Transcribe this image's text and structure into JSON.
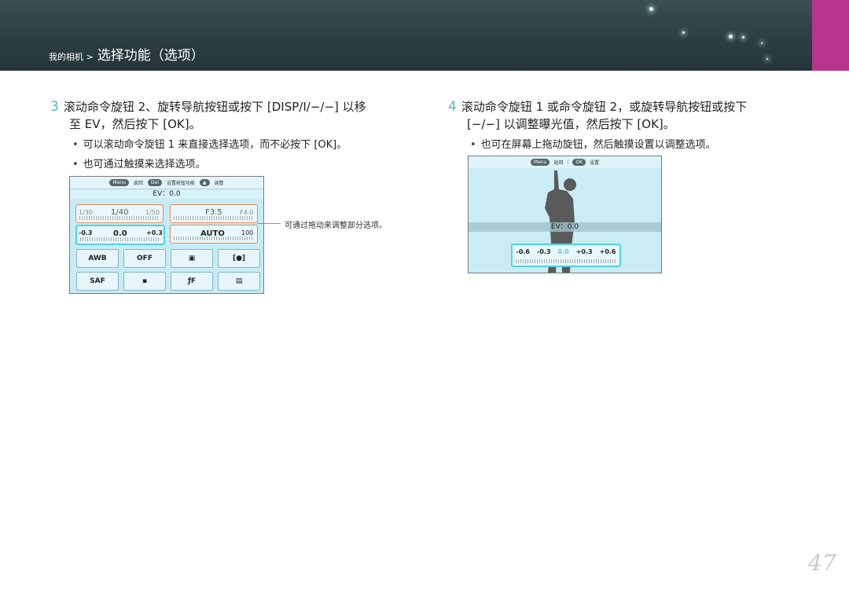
{
  "header": {
    "breadcrumb_small": "我的相机 >",
    "breadcrumb_big": "选择功能（选项）"
  },
  "step3": {
    "number": "3",
    "line1": "滚动命令旋钮 2、旋转导航按钮或按下 [DISP/I/−/−] 以移",
    "line2": "至 EV，然后按下 [OK]。",
    "bullets": [
      "可以滚动命令旋钮 1 来直接选择选项，而不必按下 [OK]。",
      "也可通过触摸来选择选项。"
    ]
  },
  "step4": {
    "number": "4",
    "line1": "滚动命令旋钮 1 或命令旋钮 2，或旋转导航按钮或按下",
    "line2": "[−/−] 以调整曝光值，然后按下 [OK]。",
    "bullets": [
      "也可在屏幕上拖动旋钮，然后触摸设置以调整选项。"
    ]
  },
  "screen1": {
    "menu_pill": "Menu",
    "back": "返回",
    "del_pill": "Del",
    "reset": "设置按钮功能",
    "display": "调整",
    "ev_label": "EV：0.0",
    "shutter": {
      "left": "1/30",
      "main": "1/40",
      "right": "1/50"
    },
    "aperture": {
      "main": "F3.5",
      "right": "F4.0"
    },
    "ev": {
      "left": "-0.3",
      "main": "0.0",
      "right": "+0.3"
    },
    "iso": {
      "main": "AUTO",
      "right": "100"
    },
    "buttons": [
      "AWB",
      "OFF",
      "▣",
      "[●]",
      "SAF",
      "▪",
      "ƒF",
      "▤"
    ]
  },
  "callout": "可通过拖动来调整部分选项。",
  "screen2": {
    "menu_pill": "Menu",
    "back": "返回",
    "ok_pill": "OK",
    "set": "设置",
    "ev_label": "EV：0.0",
    "values": [
      "-0.6",
      "-0.3",
      "0.0",
      "+0.3",
      "+0.6"
    ]
  },
  "page_number": "47",
  "colors": {
    "accent": "#b5358f",
    "step_number": "#4fb8c8",
    "header": "#2b3d40"
  }
}
